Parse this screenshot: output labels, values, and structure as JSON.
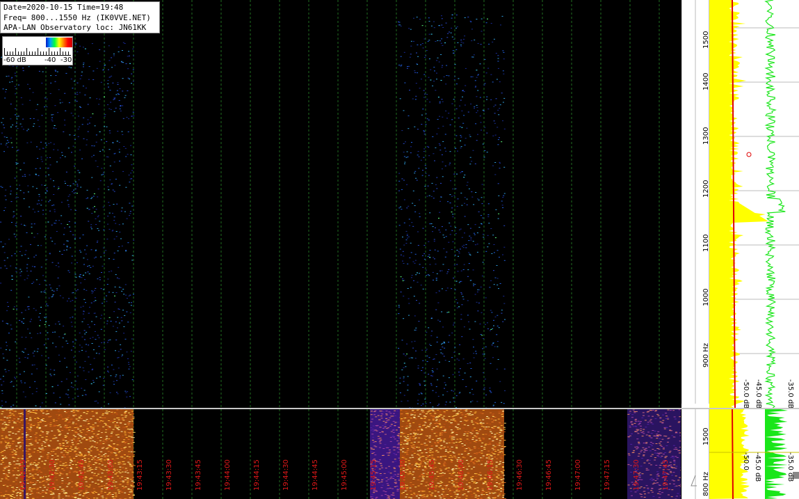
{
  "info": {
    "date_line": "Date=2020-10-15 Time=19:48",
    "freq_line": "Freq= 800...1550 Hz (IK0VVE.NET)",
    "loc_line": "APA-LAN Observatory loc: JN61KK"
  },
  "legend": {
    "low_label": "-60 dB",
    "mid_label": "-40",
    "high_label": "-30"
  },
  "spectrum": {
    "freq_labels": [
      "1500",
      "1400",
      "1300",
      "1200",
      "1100",
      "1000",
      "900 Hz"
    ],
    "db_labels": [
      "-50.0 dB",
      "-45.0 dB",
      "-35.0 dB"
    ],
    "wide_freq_labels": [
      "1500",
      "800 Hz"
    ],
    "wide_db_labels": [
      "-50.0",
      "-45.0 dB",
      "-35.0 dB"
    ]
  },
  "time_axis": {
    "labels": [
      "19:42:15",
      "19:42:30",
      "19:42:45",
      "19:43:00",
      "19:43:15",
      "19:43:30",
      "19:43:45",
      "19:44:00",
      "19:44:15",
      "19:44:30",
      "19:44:45",
      "19:45:00",
      "19:45:15",
      "19:45:30",
      "19:45:45",
      "19:46:00",
      "19:46:15",
      "19:46:30",
      "19:46:45",
      "19:47:00",
      "19:47:15",
      "19:47:30",
      "19:47:45"
    ]
  },
  "colors": {
    "trace_yellow": "#ffff00",
    "trace_green": "#19e619",
    "trace_red": "#e00000",
    "time_label": "#e01818",
    "grid": "#1f6e1f"
  }
}
